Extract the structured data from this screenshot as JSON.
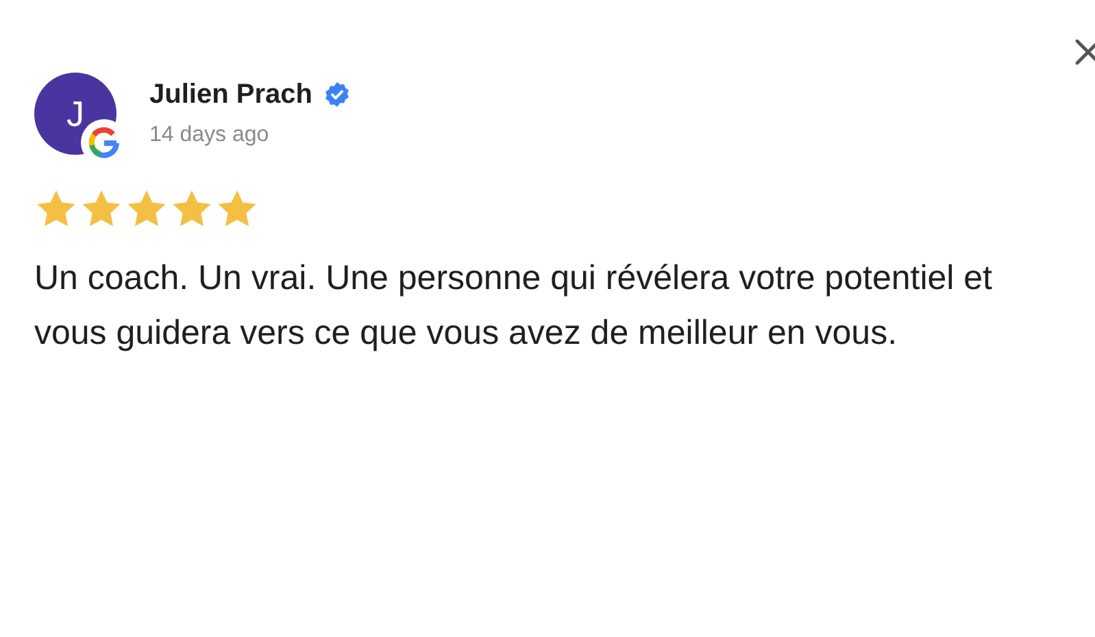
{
  "reviewer": {
    "initial": "J",
    "name": "Julien Prach",
    "verified": true,
    "time": "14 days ago"
  },
  "stars": 5,
  "text": "Un coach. Un vrai. Une personne qui révélera votre potentiel et vous guidera vers ce que vous avez de meilleur en vous."
}
